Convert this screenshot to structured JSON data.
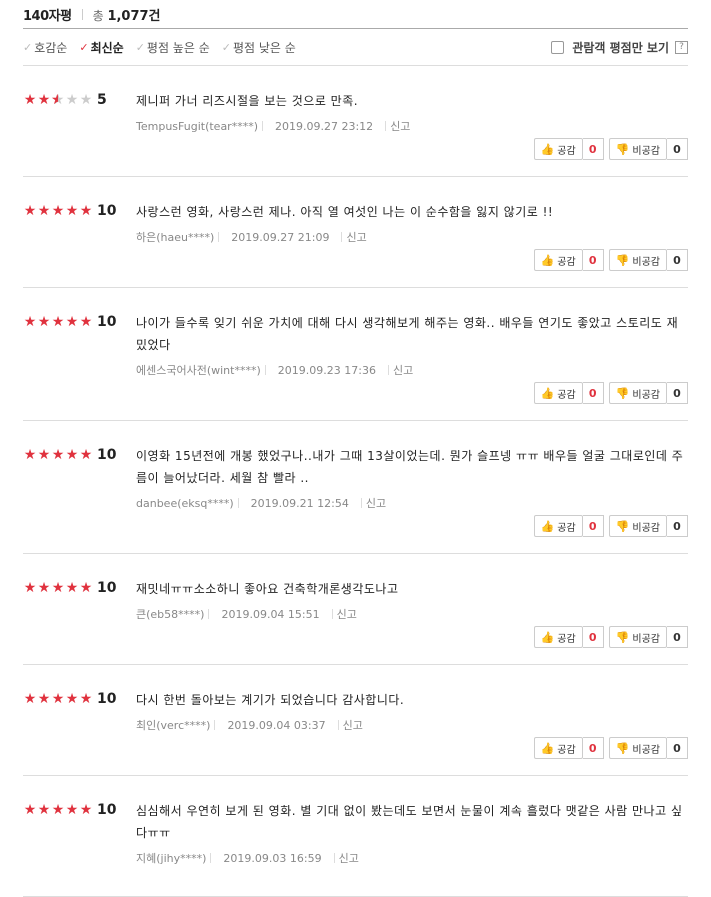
{
  "header": {
    "title": "140자평",
    "total_prefix": "총",
    "total_count": "1,077건"
  },
  "filters": {
    "items": [
      {
        "label": "호감순",
        "active": false
      },
      {
        "label": "최신순",
        "active": true
      },
      {
        "label": "평점 높은 순",
        "active": false
      },
      {
        "label": "평점 낮은 순",
        "active": false
      }
    ],
    "audience_label": "관람객 평점만 보기",
    "help_label": "?"
  },
  "labels": {
    "report": "신고",
    "like": "공감",
    "dislike": "비공감"
  },
  "accent": "#e0323e",
  "reviews": [
    {
      "score": "5",
      "rating": 5,
      "text": "제니퍼 가너 리즈시절을 보는 것으로 만족.",
      "user": "TempusFugit(tear****)",
      "date": "2019.09.27 23:12",
      "likes": "0",
      "dislikes": "0"
    },
    {
      "score": "10",
      "rating": 10,
      "text": "사랑스런 영화, 사랑스런 제나. 아직 열 여섯인 나는 이 순수함을 잃지 않기로 !!",
      "user": "하은(haeu****)",
      "date": "2019.09.27 21:09",
      "likes": "0",
      "dislikes": "0"
    },
    {
      "score": "10",
      "rating": 10,
      "text": "나이가 들수록 잊기 쉬운 가치에 대해 다시 생각해보게 해주는 영화.. 배우들 연기도 좋았고 스토리도 재밌었다",
      "user": "에센스국어사전(wint****)",
      "date": "2019.09.23 17:36",
      "likes": "0",
      "dislikes": "0"
    },
    {
      "score": "10",
      "rating": 10,
      "text": "이영화 15년전에 개봉 했었구나..내가 그때 13살이었는데. 뭔가 슬프넹 ㅠㅠ 배우들 얼굴 그대로인데 주름이 늘어났더라. 세월 참 빨라 ..",
      "user": "danbee(eksq****)",
      "date": "2019.09.21 12:54",
      "likes": "0",
      "dislikes": "0"
    },
    {
      "score": "10",
      "rating": 10,
      "text": "재밋네ㅠㅠ소소하니 좋아요 건축학개론생각도나고",
      "user": "큰(eb58****)",
      "date": "2019.09.04 15:51",
      "likes": "0",
      "dislikes": "0"
    },
    {
      "score": "10",
      "rating": 10,
      "text": "다시 한번 돌아보는 계기가 되었습니다 감사합니다.",
      "user": "최인(verc****)",
      "date": "2019.09.04 03:37",
      "likes": "0",
      "dislikes": "0"
    },
    {
      "score": "10",
      "rating": 10,
      "text": "심심해서 우연히 보게 된 영화. 별 기대 없이 봤는데도 보면서 눈물이 계속 흘렀다 맷같은 사람 만나고 싶다ㅠㅠ",
      "user": "지혜(jihy****)",
      "date": "2019.09.03 16:59",
      "likes": null,
      "dislikes": null
    }
  ]
}
